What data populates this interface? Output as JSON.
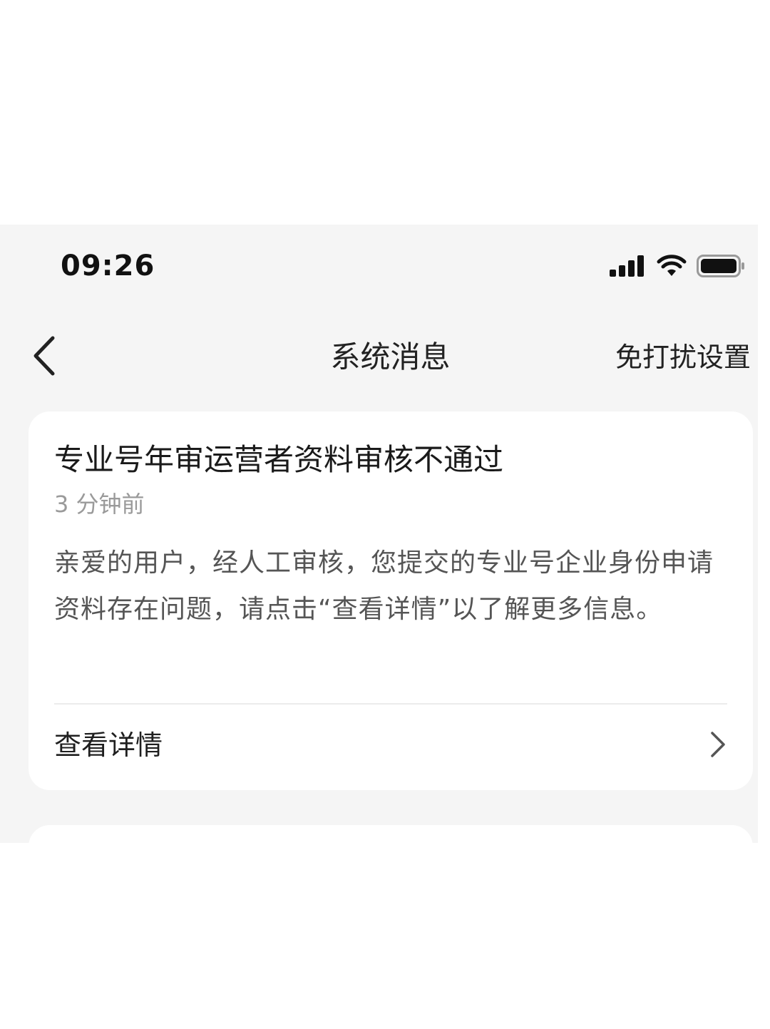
{
  "status_bar": {
    "time": "09:26",
    "icons": [
      "signal-icon",
      "wifi-icon",
      "battery-icon"
    ]
  },
  "nav": {
    "back_icon": "chevron-left-icon",
    "title": "系统消息",
    "action": "免打扰设置"
  },
  "message": {
    "title": "专业号年审运营者资料审核不通过",
    "time": "3 分钟前",
    "body": "亲爱的用户，经人工审核，您提交的专业号企业身份申请资料存在问题，请点击“查看详情”以了解更多信息。",
    "detail_label": "查看详情",
    "detail_icon": "chevron-right-icon"
  },
  "colors": {
    "screen_background": "#f5f5f5",
    "card_background": "#ffffff",
    "primary_text": "#1a1a1a",
    "secondary_text": "#9a9a9a",
    "body_text": "#555555"
  }
}
